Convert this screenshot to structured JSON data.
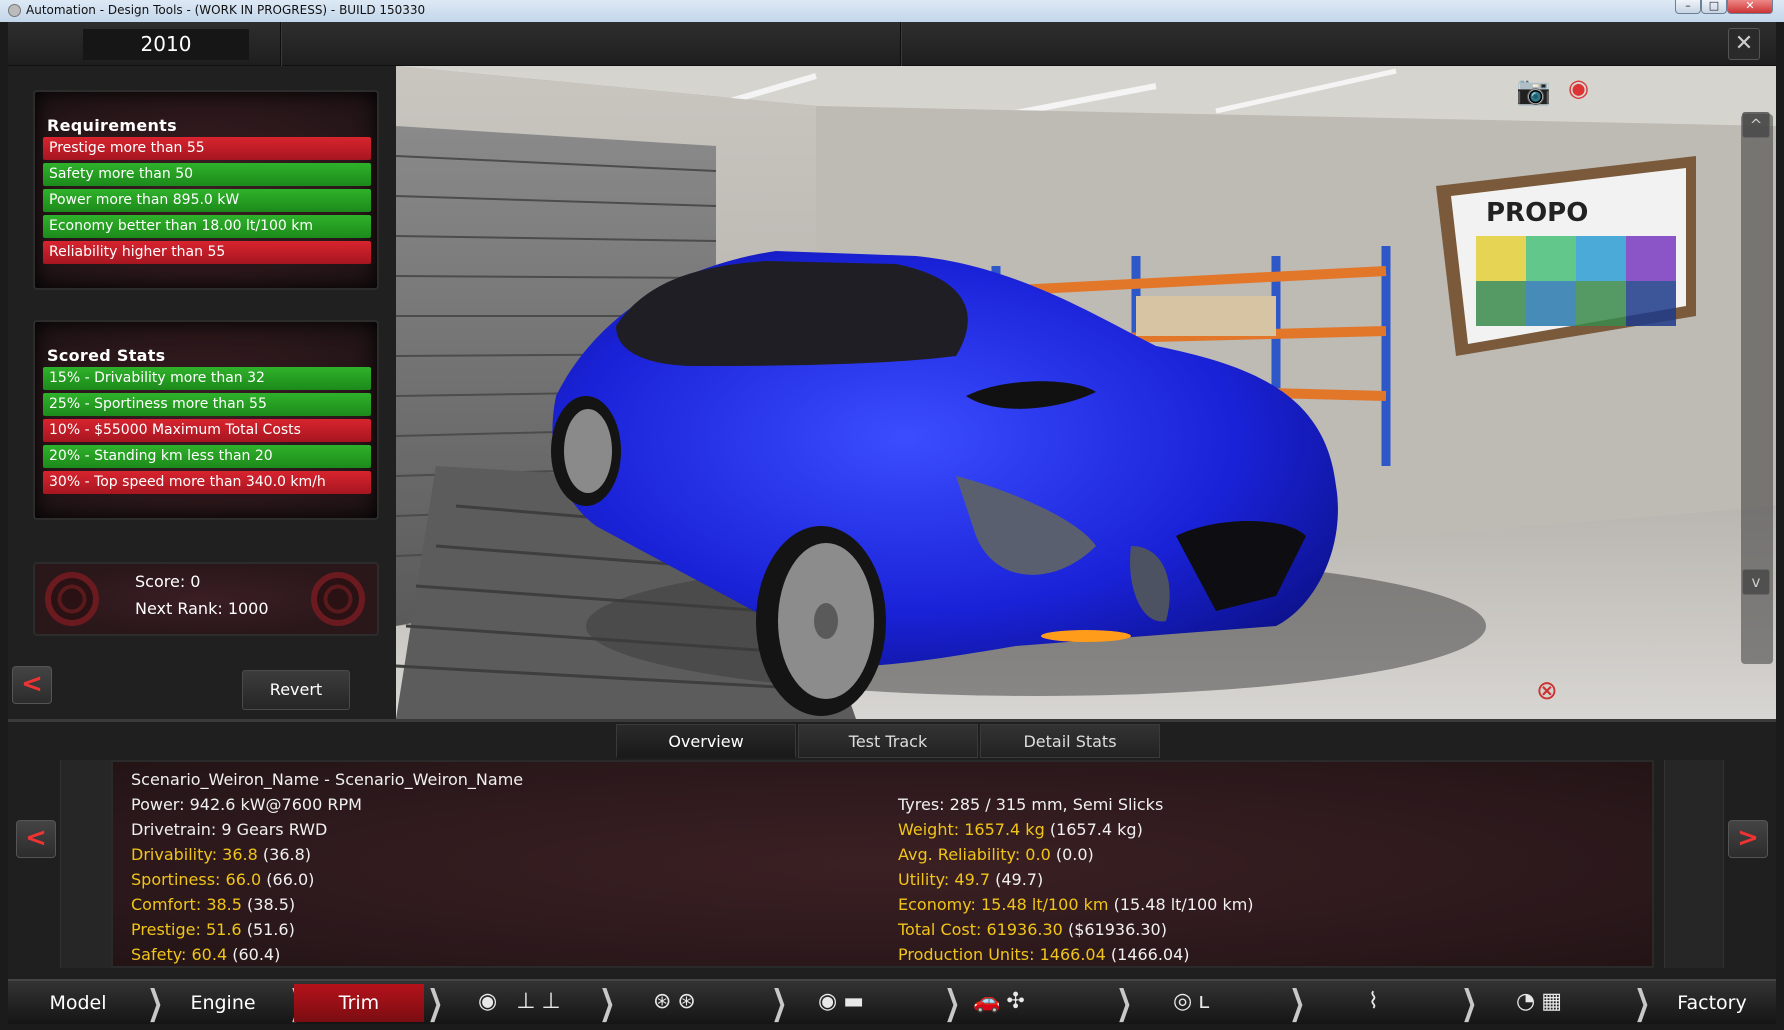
{
  "window": {
    "title": "Automation - Design Tools - (WORK IN PROGRESS) - BUILD 150330",
    "min": "–",
    "max": "□",
    "close": "✕"
  },
  "topbar": {
    "year": "2010",
    "close_label": "✕"
  },
  "requirements": {
    "heading": "Requirements",
    "items": [
      {
        "label": "Prestige more than 55",
        "status": "failed",
        "color": "#c41d26"
      },
      {
        "label": "Safety more than 50",
        "status": "passed",
        "color": "#25a023"
      },
      {
        "label": "Power more than 895.0 kW",
        "status": "passed",
        "color": "#25a023"
      },
      {
        "label": "Economy better than 18.00 lt/100 km",
        "status": "passed",
        "color": "#25a023"
      },
      {
        "label": "Reliability higher than 55",
        "status": "failed",
        "color": "#c41d26"
      }
    ]
  },
  "scored_stats": {
    "heading": "Scored Stats",
    "items": [
      {
        "label": "15% - Drivability more than 32",
        "status": "passed"
      },
      {
        "label": "25% - Sportiness more than 55",
        "status": "passed"
      },
      {
        "label": "10% - $55000 Maximum Total Costs",
        "status": "failed"
      },
      {
        "label": "20% - Standing km less than 20",
        "status": "passed"
      },
      {
        "label": "30% - Top speed more than 340.0 km/h",
        "status": "failed"
      }
    ]
  },
  "score": {
    "score_label": "Score: 0",
    "rank_label": "Next Rank: 1000"
  },
  "left_actions": {
    "back_label": "<",
    "revert_label": "Revert"
  },
  "viewport": {
    "sign_text": "PROPO",
    "up_label": "^",
    "down_label": "v",
    "camera_icon": "camera-icon",
    "eye_icon": "eye-icon"
  },
  "tabs": [
    {
      "label": "Overview",
      "active": true
    },
    {
      "label": "Test Track",
      "active": false
    },
    {
      "label": "Detail Stats",
      "active": false
    }
  ],
  "overview": {
    "name": "Scenario_Weiron_Name - Scenario_Weiron_Name",
    "left": [
      {
        "key": "Power:",
        "value": "942.6 kW@7600 RPM",
        "extra": "",
        "highlight": false
      },
      {
        "key": "Drivetrain:",
        "value": "9 Gears RWD",
        "extra": "",
        "highlight": false
      },
      {
        "key": "Drivability:",
        "value": "36.8",
        "extra": "(36.8)",
        "highlight": true
      },
      {
        "key": "Sportiness:",
        "value": "66.0",
        "extra": "(66.0)",
        "highlight": true
      },
      {
        "key": "Comfort:",
        "value": "38.5",
        "extra": "(38.5)",
        "highlight": true
      },
      {
        "key": "Prestige:",
        "value": "51.6",
        "extra": "(51.6)",
        "highlight": true
      },
      {
        "key": "Safety:",
        "value": "60.4",
        "extra": "(60.4)",
        "highlight": true
      }
    ],
    "right": [
      {
        "key": "Tyres:",
        "value": "285 / 315 mm, Semi Slicks",
        "extra": "",
        "highlight": false
      },
      {
        "key": "Weight:",
        "value": "1657.4 kg",
        "extra": "(1657.4 kg)",
        "highlight": true
      },
      {
        "key": "Avg. Reliability:",
        "value": "0.0",
        "extra": "(0.0)",
        "highlight": true
      },
      {
        "key": "Utility:",
        "value": "49.7",
        "extra": "(49.7)",
        "highlight": true
      },
      {
        "key": "Economy:",
        "value": "15.48 lt/100 km",
        "extra": "(15.48 lt/100 km)",
        "highlight": true
      },
      {
        "key": "Total Cost:",
        "value": "61936.30",
        "extra": "($61936.30)",
        "highlight": true
      },
      {
        "key": "Production Units:",
        "value": "1466.04",
        "extra": "(1466.04)",
        "highlight": true
      }
    ],
    "prev_label": "<",
    "next_label": ">"
  },
  "bottom_nav": {
    "model": "Model",
    "engine": "Engine",
    "trim": "Trim",
    "factory": "Factory",
    "icons": [
      "gearbox-icon",
      "wheels-icon",
      "body-icon",
      "car-aero-icon",
      "interior-icon",
      "suspension-icon",
      "test-track-icon"
    ]
  }
}
